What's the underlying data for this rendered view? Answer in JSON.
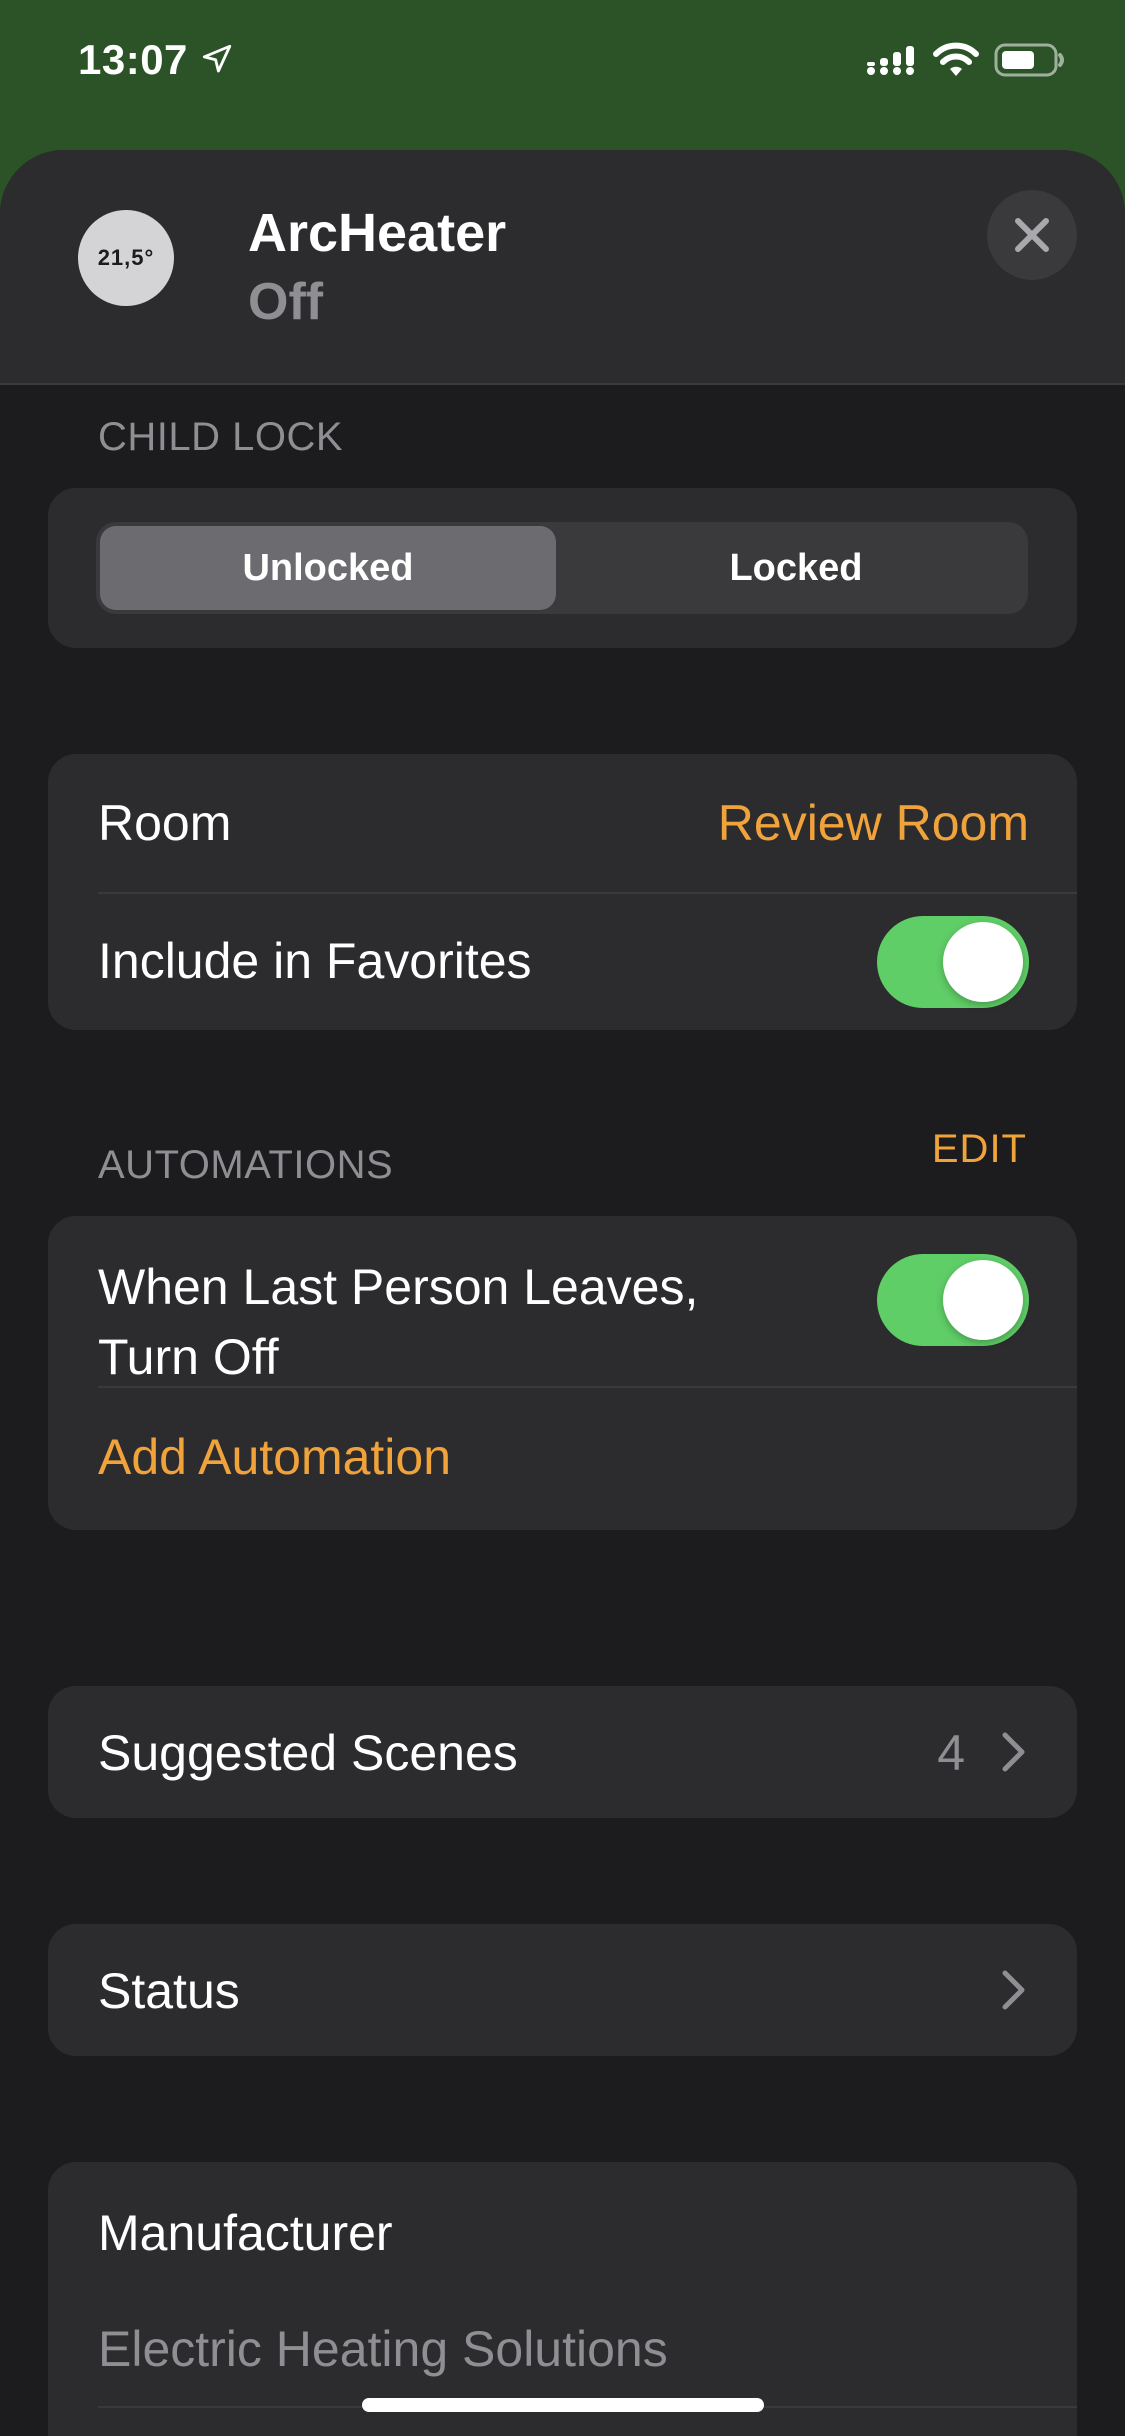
{
  "status_bar": {
    "time": "13:07",
    "icons": [
      "location-arrow-icon",
      "signal-icon",
      "wifi-icon",
      "battery-icon"
    ]
  },
  "header": {
    "device_icon_text": "21,5°",
    "device_name": "ArcHeater",
    "device_state": "Off",
    "close_icon": "close-icon"
  },
  "child_lock": {
    "section_label": "CHILD LOCK",
    "segments": [
      "Unlocked",
      "Locked"
    ],
    "selected": "Unlocked"
  },
  "room_card": {
    "room_label": "Room",
    "room_value": "Review Room",
    "favorites_label": "Include in Favorites",
    "favorites_on": true
  },
  "automations": {
    "section_label": "AUTOMATIONS",
    "edit_label": "EDIT",
    "items": [
      {
        "label_line1": "When Last Person Leaves,",
        "label_line2": "Turn Off",
        "enabled": true
      }
    ],
    "add_label": "Add Automation"
  },
  "suggested_scenes": {
    "label": "Suggested Scenes",
    "count": "4"
  },
  "status_row": {
    "label": "Status"
  },
  "manufacturer": {
    "label": "Manufacturer",
    "value": "Electric Heating Solutions"
  },
  "colors": {
    "accent": "#f0a33b",
    "toggle_on": "#5fce67",
    "background": "#1c1c1e",
    "card": "#2c2c2e",
    "status_bar": "#2b5327"
  }
}
